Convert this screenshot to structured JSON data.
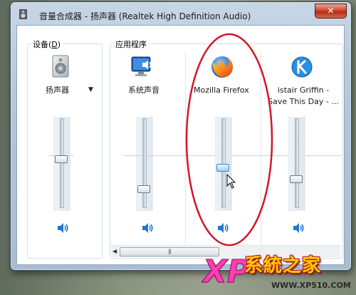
{
  "window": {
    "title": "音量合成器 - 扬声器 (Realtek High Definition Audio)",
    "close_glyph": "✕"
  },
  "devices": {
    "group_label": "设备(",
    "group_label_accel": "D",
    "group_label_end": ")",
    "device_name": "扬声器",
    "dropdown_glyph": "▼",
    "volume_fraction": 0.57
  },
  "applications": {
    "group_label": "应用程序",
    "channels": [
      {
        "name": "系统声音",
        "icon": "system-sounds-icon",
        "volume_fraction": 0.22
      },
      {
        "name_line1": "Mozilla Firefox",
        "icon": "firefox-icon",
        "volume_fraction": 0.47
      },
      {
        "name_line1": "istair Griffin -",
        "name_line2": "Save This Day - ...",
        "icon": "k-app-icon",
        "volume_fraction": 0.33
      }
    ]
  },
  "scrollbar": {
    "left_arrow": "◀",
    "thumb_grip": "|||"
  },
  "watermark": {
    "logo_letters": "XP",
    "name": "系統之家",
    "url": "WWW.XP510.COM"
  },
  "colors": {
    "annotation_red": "#d4162a",
    "accent_blue": "#2277cc"
  }
}
